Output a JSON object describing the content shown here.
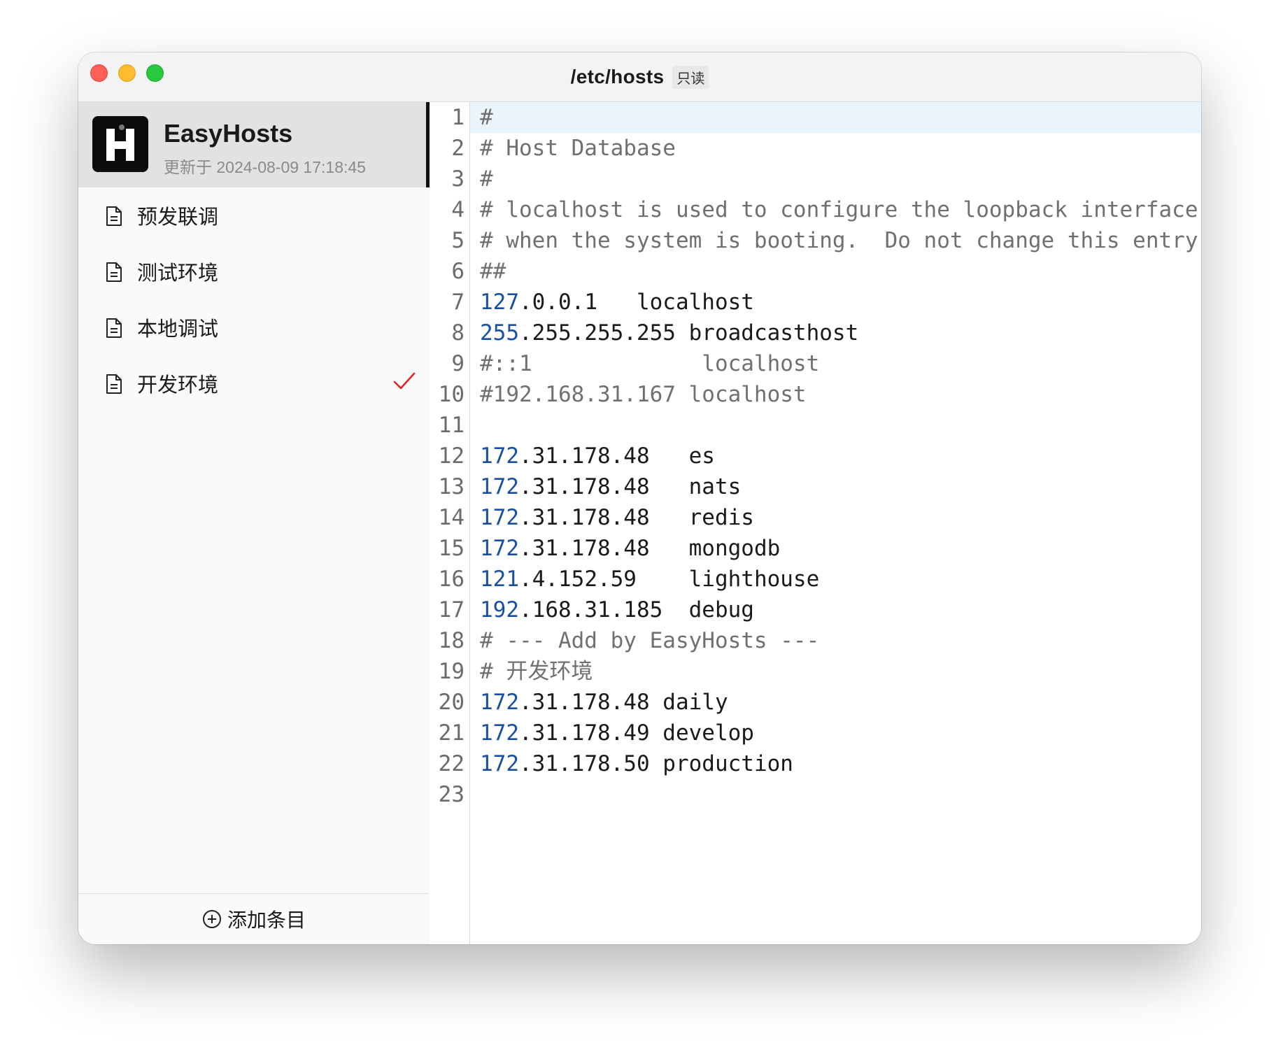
{
  "window": {
    "title": "/etc/hosts",
    "badge": "只读"
  },
  "app": {
    "name": "EasyHosts",
    "updated": "更新于 2024-08-09 17:18:45"
  },
  "environments": [
    {
      "label": "预发联调",
      "active": false
    },
    {
      "label": "测试环境",
      "active": false
    },
    {
      "label": "本地调试",
      "active": false
    },
    {
      "label": "开发环境",
      "active": true
    }
  ],
  "add_button": {
    "label": "添加条目"
  },
  "editor": {
    "active_line": 1,
    "lines": [
      {
        "n": "1",
        "kind": "comment",
        "text": "#"
      },
      {
        "n": "2",
        "kind": "comment",
        "text": "# Host Database"
      },
      {
        "n": "3",
        "kind": "comment",
        "text": "#"
      },
      {
        "n": "4",
        "kind": "comment",
        "text": "# localhost is used to configure the loopback interface"
      },
      {
        "n": "5",
        "kind": "comment",
        "text": "# when the system is booting.  Do not change this entry."
      },
      {
        "n": "6",
        "kind": "comment",
        "text": "##"
      },
      {
        "n": "7",
        "kind": "entry",
        "num": "127",
        "rest": ".0.0.1   localhost"
      },
      {
        "n": "8",
        "kind": "entry",
        "num": "255",
        "rest": ".255.255.255 broadcasthost"
      },
      {
        "n": "9",
        "kind": "comment",
        "text": "#::1             localhost"
      },
      {
        "n": "10",
        "kind": "comment",
        "text": "#192.168.31.167 localhost"
      },
      {
        "n": "11",
        "kind": "blank",
        "text": ""
      },
      {
        "n": "12",
        "kind": "entry",
        "num": "172",
        "rest": ".31.178.48   es"
      },
      {
        "n": "13",
        "kind": "entry",
        "num": "172",
        "rest": ".31.178.48   nats"
      },
      {
        "n": "14",
        "kind": "entry",
        "num": "172",
        "rest": ".31.178.48   redis"
      },
      {
        "n": "15",
        "kind": "entry",
        "num": "172",
        "rest": ".31.178.48   mongodb"
      },
      {
        "n": "16",
        "kind": "entry",
        "num": "121",
        "rest": ".4.152.59    lighthouse"
      },
      {
        "n": "17",
        "kind": "entry",
        "num": "192",
        "rest": ".168.31.185  debug"
      },
      {
        "n": "18",
        "kind": "comment",
        "text": "# --- Add by EasyHosts ---"
      },
      {
        "n": "19",
        "kind": "comment",
        "text": "# 开发环境"
      },
      {
        "n": "20",
        "kind": "entry",
        "num": "172",
        "rest": ".31.178.48 daily"
      },
      {
        "n": "21",
        "kind": "entry",
        "num": "172",
        "rest": ".31.178.49 develop"
      },
      {
        "n": "22",
        "kind": "entry",
        "num": "172",
        "rest": ".31.178.50 production"
      },
      {
        "n": "23",
        "kind": "blank",
        "text": ""
      }
    ]
  },
  "colors": {
    "accent_check": "#e02424",
    "number": "#1a4fa0",
    "comment": "#707070",
    "active_line_bg": "#eaf4fc"
  },
  "icons": {
    "env_item": "document-icon",
    "active": "checkmark-icon",
    "add": "plus-circle-icon",
    "logo": "h-logo-icon"
  }
}
